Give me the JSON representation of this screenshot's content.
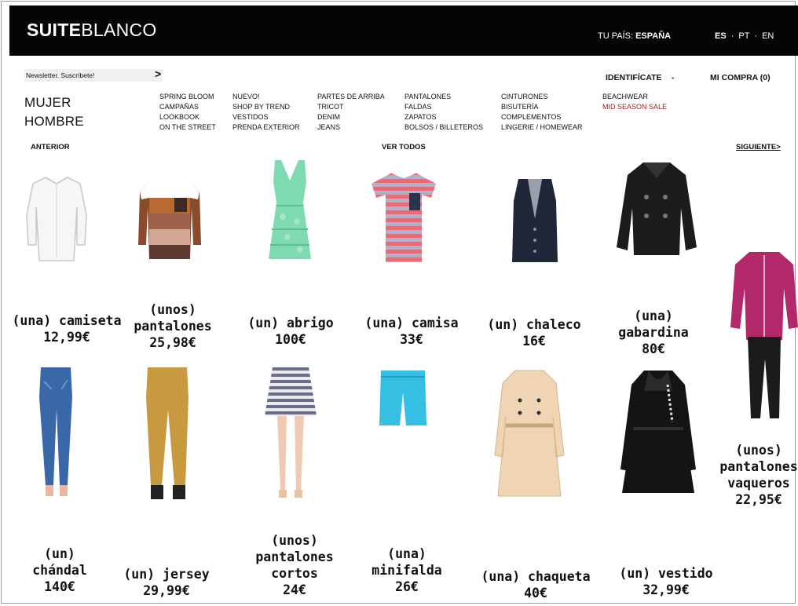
{
  "header": {
    "logo_bold": "SUITE",
    "logo_light": "BLANCO",
    "country_label": "TU PAÍS:",
    "country_value": "ESPAÑA",
    "langs": [
      "ES",
      "PT",
      "EN"
    ],
    "lang_sep": "·"
  },
  "newsletter": {
    "label": "Newsletter. Suscríbete!"
  },
  "account": {
    "login_label": "IDENTIFÍCATE",
    "login_dash": "-",
    "cart_label": "MI COMPRA (0)"
  },
  "gender": {
    "women": "MUJER",
    "men": "HOMBRE"
  },
  "menu": {
    "col1": [
      "SPRING BLOOM",
      "CAMPAÑAS",
      "LOOKBOOK",
      "ON THE STREET"
    ],
    "col2": [
      "NUEVO!",
      "SHOP BY TREND",
      "VESTIDOS",
      "PRENDA EXTERIOR"
    ],
    "col3": [
      "PARTES DE ARRIBA",
      "TRICOT",
      "DENIM",
      "JEANS"
    ],
    "col4": [
      "PANTALONES",
      "FALDAS",
      "ZAPATOS",
      "BOLSOS / BILLETEROS"
    ],
    "col5": [
      "CINTURONES",
      "BISUTERÍA",
      "COMPLEMENTOS",
      "LINGERIE / HOMEWEAR"
    ],
    "col6": [
      "BEACHWEAR",
      "MID SEASON SALE"
    ]
  },
  "pager": {
    "prev": "ANTERIOR",
    "all": "VER TODOS",
    "next": "SIGUIENTE>"
  },
  "products": [
    {
      "name": "(una) camiseta",
      "price": "12,99€",
      "icon": "white-blouse-icon"
    },
    {
      "name": "(unos) pantalones",
      "price": "25,98€",
      "icon": "striped-sweater-icon"
    },
    {
      "name": "(un) abrigo",
      "price": "100€",
      "icon": "green-dress-icon"
    },
    {
      "name": "(una) camisa",
      "price": "33€",
      "icon": "striped-tshirt-icon"
    },
    {
      "name": "(un) chaleco",
      "price": "16€",
      "icon": "vest-icon"
    },
    {
      "name": "(una) gabardina",
      "price": "80€",
      "icon": "black-jacket-icon"
    },
    {
      "name": "(unos) pantalones vaqueros",
      "price": "22,95€",
      "icon": "tracksuit-icon"
    },
    {
      "name": "(un) chándal",
      "price": "140€",
      "icon": "jeans-icon"
    },
    {
      "name": "(un) jersey",
      "price": "29,99€",
      "icon": "chinos-icon"
    },
    {
      "name": "(unos) pantalones cortos",
      "price": "24€",
      "icon": "skirt-icon"
    },
    {
      "name": "(una) minifalda",
      "price": "26€",
      "icon": "shorts-icon"
    },
    {
      "name": "(una) chaqueta",
      "price": "40€",
      "icon": "trench-coat-icon"
    },
    {
      "name": "(un) vestido",
      "price": "32,99€",
      "icon": "black-coat-icon"
    }
  ],
  "label_lines": {
    "p0": [
      "(una) camiseta"
    ],
    "p1": [
      "(unos)",
      "pantalones"
    ],
    "p2": [
      "(un) abrigo"
    ],
    "p3": [
      "(una) camisa"
    ],
    "p4": [
      "(un) chaleco"
    ],
    "p5": [
      "(una)",
      "gabardina"
    ],
    "p6": [
      "(unos)",
      "pantalones",
      "vaqueros"
    ],
    "p7": [
      "(un)",
      "chándal"
    ],
    "p8": [
      "(un) jersey"
    ],
    "p9": [
      "(unos)",
      "pantalones",
      "cortos"
    ],
    "p10": [
      "(una)",
      "minifalda"
    ],
    "p11": [
      "(una) chaqueta"
    ],
    "p12": [
      "(un) vestido"
    ]
  },
  "colors": {
    "topbar": "#050505",
    "sale": "#9b1c1c",
    "newsletter_bg": "#f0f0ec"
  }
}
